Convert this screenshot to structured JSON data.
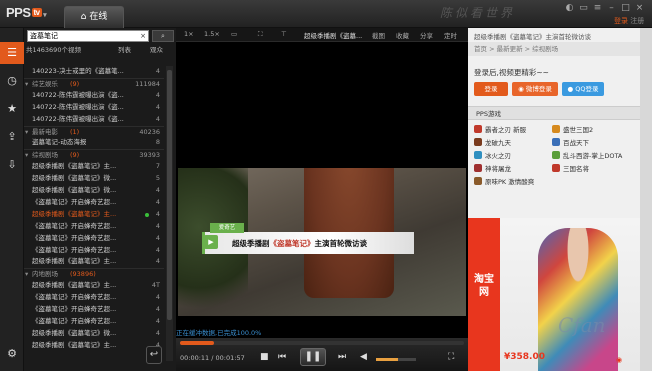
{
  "app": {
    "logo_text": "PPS",
    "logo_badge": "tv",
    "online_tab": "在线",
    "home_icon": "home-icon",
    "watermark": "陈似看世界",
    "login": "登录",
    "register": "注册"
  },
  "search": {
    "value": "盗墓笔记",
    "clear": "×",
    "button_icon": "search-icon"
  },
  "list_header": {
    "summary": "共1463690个视频",
    "col_list": "列表",
    "col_views": "观众"
  },
  "list_rows": [
    {
      "type": "item",
      "text": "140223-决士或里的《盗墓笔...",
      "count": "4"
    },
    {
      "type": "cat",
      "text": "综艺娱乐",
      "cnum": "(9)",
      "count": "111984"
    },
    {
      "type": "item",
      "text": "140722-陈伟霆被曝出演《盗...",
      "count": "4"
    },
    {
      "type": "item",
      "text": "140722-陈伟霆被曝出演《盗...",
      "count": "4"
    },
    {
      "type": "item",
      "text": "140722-陈伟霆被曝出演《盗...",
      "count": "4"
    },
    {
      "type": "cat",
      "text": "最新电影",
      "cnum": "(1)",
      "count": "40236"
    },
    {
      "type": "item",
      "text": "盗墓笔记-动态海报",
      "count": "8"
    },
    {
      "type": "cat",
      "text": "综视剧场",
      "cnum": "(9)",
      "count": "39393"
    },
    {
      "type": "item",
      "text": "超级季播剧《盗墓笔记》主...",
      "count": "7"
    },
    {
      "type": "item",
      "text": "超级季播剧《盗墓笔记》微...",
      "count": "5"
    },
    {
      "type": "item",
      "text": "超级季播剧《盗墓笔记》微...",
      "count": "4"
    },
    {
      "type": "item",
      "text": "《盗墓笔记》开启蜂奇艺超...",
      "count": "4"
    },
    {
      "type": "item",
      "hl": true,
      "text": "超级季播剧《盗墓笔记》主...",
      "count": "4"
    },
    {
      "type": "item",
      "text": "《盗墓笔记》开启蜂奇艺超...",
      "count": "4"
    },
    {
      "type": "item",
      "text": "《盗墓笔记》开启蜂奇艺超...",
      "count": "4"
    },
    {
      "type": "item",
      "text": "《盗墓笔记》开启蜂奇艺超...",
      "count": "4"
    },
    {
      "type": "item",
      "text": "超级季播剧《盗墓笔记》主...",
      "count": "4"
    },
    {
      "type": "cat",
      "text": "内地剧场",
      "cnum": "(93896)",
      "count": ""
    },
    {
      "type": "item",
      "text": "超级季播剧《盗墓笔记》主...",
      "count": "4T"
    },
    {
      "type": "item",
      "text": "《盗墓笔记》开启蜂奇艺超...",
      "count": "4"
    },
    {
      "type": "item",
      "text": "《盗墓笔记》开启蜂奇艺超...",
      "count": "4"
    },
    {
      "type": "item",
      "text": "《盗墓笔记》开启蜂奇艺超...",
      "count": "4"
    },
    {
      "type": "item",
      "text": "超级季播剧《盗墓笔记》微...",
      "count": "4"
    },
    {
      "type": "item",
      "text": "超级季播剧《盗墓笔记》主...",
      "count": "4"
    }
  ],
  "toolbar": {
    "speed_1x": "1×",
    "speed_15x": "1.5×",
    "title": "超级季播剧《盗墓...",
    "screenshot": "截图",
    "favorite": "收藏",
    "share": "分享",
    "timer": "定时"
  },
  "banner": {
    "logo": "爱奇艺",
    "text_a": "超级季播剧",
    "text_b": "《盗墓笔记》",
    "text_c": "主演首轮微访谈"
  },
  "player": {
    "buffer_text": "正在缓冲数据,已完成100.0%",
    "time_current": "00:00:11",
    "time_total": "00:01:57",
    "progress": 0.12,
    "volume": 0.55
  },
  "right": {
    "title": "超级季播剧《盗墓笔记》主演首轮微访谈",
    "breadcrumb": "首页 > 最新更新 > 综视剧场",
    "login_msg": "登录后,视频更精彩~~",
    "btn_login": "登录",
    "btn_weibo": "微博登录",
    "btn_qq": "QQ登录",
    "games_header": "PPS游戏",
    "games": [
      {
        "name": "霸者之刃 新服",
        "color": "#c0392b"
      },
      {
        "name": "盛世三国2",
        "color": "#d68a1e"
      },
      {
        "name": "龙破九天",
        "color": "#7a3b1e"
      },
      {
        "name": "百战天下",
        "color": "#3a6fb8"
      },
      {
        "name": "冰火之刃",
        "color": "#2f8fc0"
      },
      {
        "name": "乱斗西游-掌上DOTA",
        "color": "#5a9e3a"
      },
      {
        "name": "神将屠龙",
        "color": "#a03030"
      },
      {
        "name": "三国名将",
        "color": "#c0392b"
      },
      {
        "name": "原味PK 激情酸爽",
        "color": "#8a5a2a"
      }
    ],
    "ad_brand": "淘宝网",
    "ad_price": "¥358.00",
    "ad_badge": "◉",
    "ad_watermark": "Cfan"
  }
}
